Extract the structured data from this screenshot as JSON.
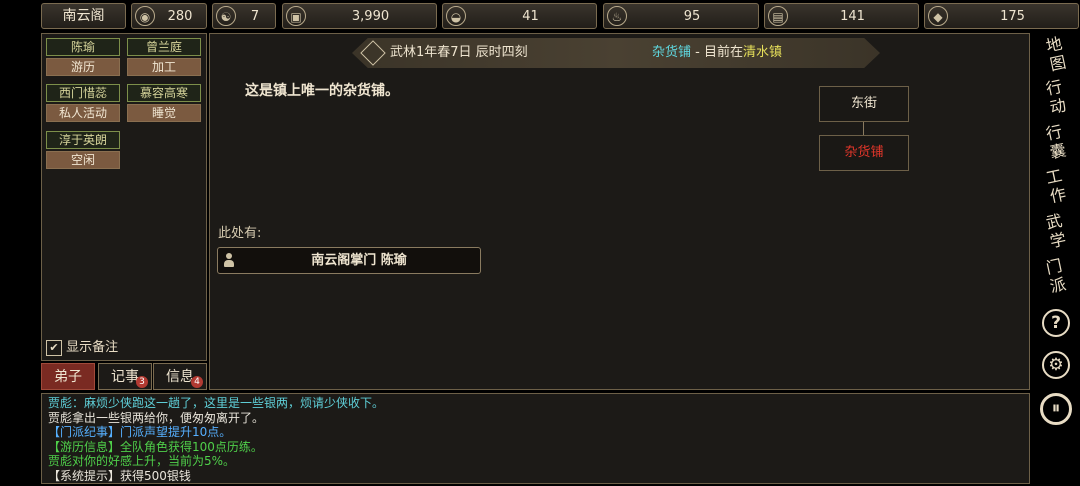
{
  "topbar": {
    "sect_name": "南云阁",
    "stats": [
      {
        "icon": "coin-bag-icon",
        "glyph": "◉",
        "value": "280"
      },
      {
        "icon": "yin-yang-icon",
        "glyph": "☯",
        "value": "7"
      },
      {
        "icon": "copper-coin-icon",
        "glyph": "▣",
        "value": "3,990"
      },
      {
        "icon": "rice-bowl-icon",
        "glyph": "◒",
        "value": "41"
      },
      {
        "icon": "herb-icon",
        "glyph": "♨",
        "value": "95"
      },
      {
        "icon": "wood-log-icon",
        "glyph": "▤",
        "value": "141"
      },
      {
        "icon": "ore-icon",
        "glyph": "◆",
        "value": "175"
      }
    ]
  },
  "disciples": [
    {
      "name": "陈瑜",
      "activity": "游历"
    },
    {
      "name": "曾兰庭",
      "activity": "加工"
    },
    {
      "name": "西门惜蕊",
      "activity": "私人活动"
    },
    {
      "name": "慕容高寒",
      "activity": "睡觉"
    },
    {
      "name": "淳于英朗",
      "activity": "空闲"
    }
  ],
  "show_notes_label": "显示备注",
  "tabs": {
    "disciples": "弟子",
    "records": "记事",
    "records_badge": "3",
    "info": "信息",
    "info_badge": "4"
  },
  "header": {
    "date": "武林1年春7日 辰时四刻",
    "location_name": "杂货铺",
    "separator": " - ",
    "location_prefix": "目前在",
    "town": "清水镇"
  },
  "description": "这是镇上唯一的杂货铺。",
  "present": {
    "label": "此处有:",
    "npc": "南云阁掌门 陈瑜"
  },
  "minimap": {
    "north": "东街",
    "current": "杂货铺"
  },
  "sidebar": [
    {
      "label": "地图",
      "icon": "map-icon"
    },
    {
      "label": "行动",
      "icon": "action-icon"
    },
    {
      "label": "行囊",
      "icon": "bag-icon"
    },
    {
      "label": "工作",
      "icon": "work-icon"
    },
    {
      "label": "武学",
      "icon": "martial-arts-icon"
    },
    {
      "label": "门派",
      "icon": "sect-icon"
    },
    {
      "label": "?",
      "icon": "help-icon"
    },
    {
      "label": "⚙",
      "icon": "settings-icon"
    },
    {
      "label": "⏸",
      "icon": "pause-icon"
    }
  ],
  "log": [
    {
      "text": "贾彪：麻烦少侠跑这一趟了，这里是一些银两，烦请少侠收下。",
      "color": "#5fcfd8"
    },
    {
      "text": "贾彪拿出一些银两给你，便匆匆离开了。",
      "color": "#e8e4da"
    },
    {
      "text": "【门派纪事】门派声望提升10点。",
      "color": "#56b0ff"
    },
    {
      "text": "【游历信息】全队角色获得100点历练。",
      "color": "#4fd04a"
    },
    {
      "text": "贾彪对你的好感上升，当前为5%。",
      "color": "#4fd04a"
    },
    {
      "text": "【系统提示】获得500银钱",
      "color": "#e8e4da"
    }
  ]
}
